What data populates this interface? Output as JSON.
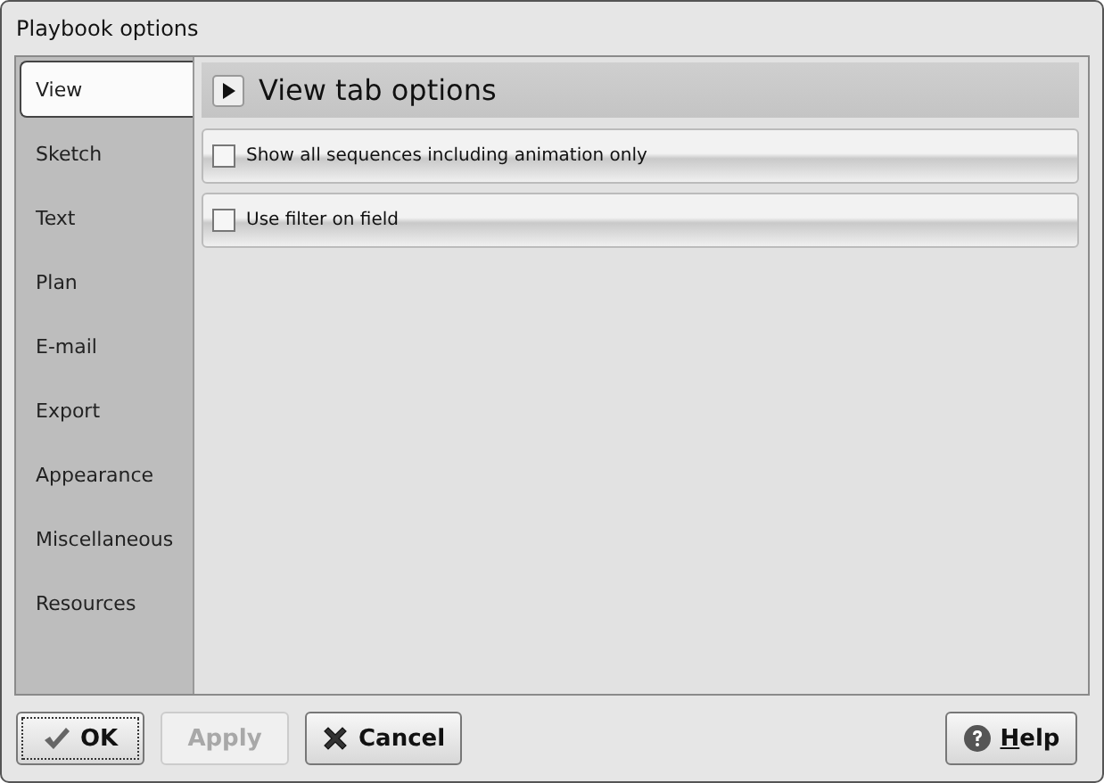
{
  "window": {
    "title": "Playbook options"
  },
  "sidebar": {
    "items": [
      {
        "label": "View",
        "selected": true
      },
      {
        "label": "Sketch",
        "selected": false
      },
      {
        "label": "Text",
        "selected": false
      },
      {
        "label": "Plan",
        "selected": false
      },
      {
        "label": "E-mail",
        "selected": false
      },
      {
        "label": "Export",
        "selected": false
      },
      {
        "label": "Appearance",
        "selected": false
      },
      {
        "label": "Miscellaneous",
        "selected": false
      },
      {
        "label": "Resources",
        "selected": false
      }
    ]
  },
  "panel": {
    "title": "View tab options",
    "options": [
      {
        "label": "Show all sequences including animation only",
        "checked": false
      },
      {
        "label": "Use filter on field",
        "checked": false
      }
    ]
  },
  "buttons": [
    {
      "kind": "ok",
      "label": "OK",
      "disabled": false
    },
    {
      "kind": "apply",
      "label": "Apply",
      "disabled": true
    },
    {
      "kind": "cancel",
      "label": "Cancel",
      "disabled": false
    },
    {
      "kind": "help",
      "label": "Help",
      "disabled": false
    }
  ]
}
